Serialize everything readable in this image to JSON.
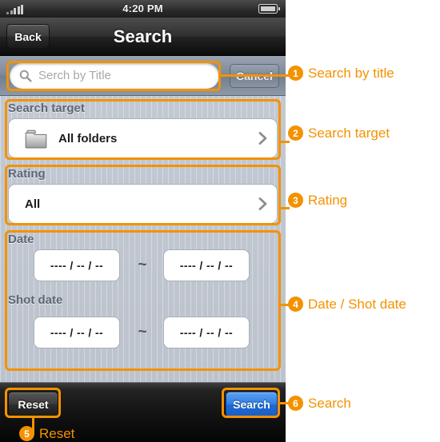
{
  "statusbar": {
    "time": "4:20 PM",
    "signal_icon": "signal-bars-icon",
    "battery_icon": "battery-icon"
  },
  "navbar": {
    "title": "Search",
    "back_label": "Back"
  },
  "search": {
    "placeholder": "Serch by Title",
    "value": "",
    "cancel_label": "Cancel",
    "icon": "search-icon"
  },
  "sections": {
    "target": {
      "label": "Search target",
      "value": "All folders",
      "icon": "folder-icon",
      "chevron": "chevron-right-icon"
    },
    "rating": {
      "label": "Rating",
      "value": "All",
      "chevron": "chevron-right-icon"
    },
    "date": {
      "label": "Date",
      "from": "---- / -- / --",
      "to": "---- / -- / --",
      "separator": "~"
    },
    "shot_date": {
      "label": "Shot date",
      "from": "---- / -- / --",
      "to": "---- / -- / --",
      "separator": "~"
    }
  },
  "toolbar": {
    "reset_label": "Reset",
    "search_label": "Search"
  },
  "callouts": [
    {
      "number": "1",
      "text": "Search by title"
    },
    {
      "number": "2",
      "text": "Search target"
    },
    {
      "number": "3",
      "text": "Rating"
    },
    {
      "number": "4",
      "text": "Date / Shot date"
    },
    {
      "number": "5",
      "text": "Reset"
    },
    {
      "number": "6",
      "text": "Search"
    }
  ],
  "colors": {
    "accent": "#f39200",
    "action": "#2f7fe6",
    "panel": "#bcc3cd"
  }
}
